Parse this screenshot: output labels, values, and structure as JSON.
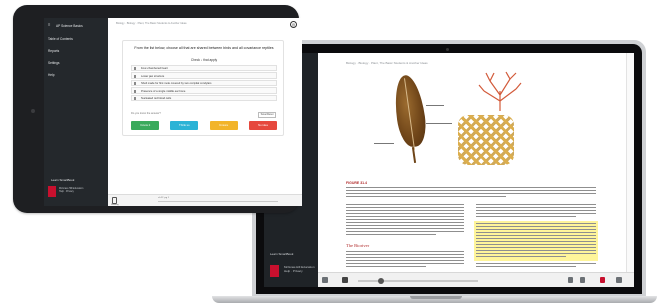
{
  "tablet": {
    "sidebar": {
      "menu_icon": "hamburger-icon",
      "title": "AP Science Basics",
      "items": [
        {
          "label": "Table of Contents"
        },
        {
          "label": "Reports"
        },
        {
          "label": "Settings"
        },
        {
          "label": "Help"
        }
      ],
      "learn_label": "Learn SmartBook",
      "logo_text_1": "McGraw-Hill Education",
      "logo_text_2": "Help · Privacy"
    },
    "header": {
      "breadcrumb": "Biology · Biology · Plant, The Basic Students & Another Ideas"
    },
    "question": {
      "prompt": "From the list below, choose all that are shared between birds and all covariance reptiles",
      "instruction": "Check ↓ that apply",
      "options": [
        {
          "text": "Four-chambered heart"
        },
        {
          "text": "Lower jaw structure"
        },
        {
          "text": "Shell made for first mole covered by two occipital condylars"
        },
        {
          "text": "Presence of a single middle ear bone"
        },
        {
          "text": "Nucleated red blood cells"
        }
      ],
      "confidence_prompt": "Do you know the answer?",
      "reset_label": "Save/Reset"
    },
    "buttons": [
      {
        "label": "I know it",
        "color": "#3aaa5c"
      },
      {
        "label": "Think so",
        "color": "#2bb3d6"
      },
      {
        "label": "Unsure",
        "color": "#f2b42a"
      },
      {
        "label": "No idea",
        "color": "#e6483d"
      }
    ],
    "bottom": {
      "icon": "book-icon",
      "label": "Reading",
      "page": "ch.12 ·pg 1"
    }
  },
  "laptop": {
    "breadcrumb": "Biology · Biology · Plant, The Basic Students & Another Ideas",
    "figure_title": "FIGURE 31.4",
    "section_heading": "The Bioriver",
    "sidebar": {
      "learn_label": "Learn SmartBook",
      "logo_text_1": "McGraw-Hill Education",
      "logo_text_2": "Help · Privacy"
    },
    "bottom_icons": [
      "book-icon",
      "play-icon",
      "back-icon",
      "next-icon",
      "font-icon",
      "menu-icon"
    ]
  },
  "colors": {
    "brand_red": "#c8102e",
    "sidebar_dark": "#24282c",
    "highlight": "#fff59a"
  }
}
